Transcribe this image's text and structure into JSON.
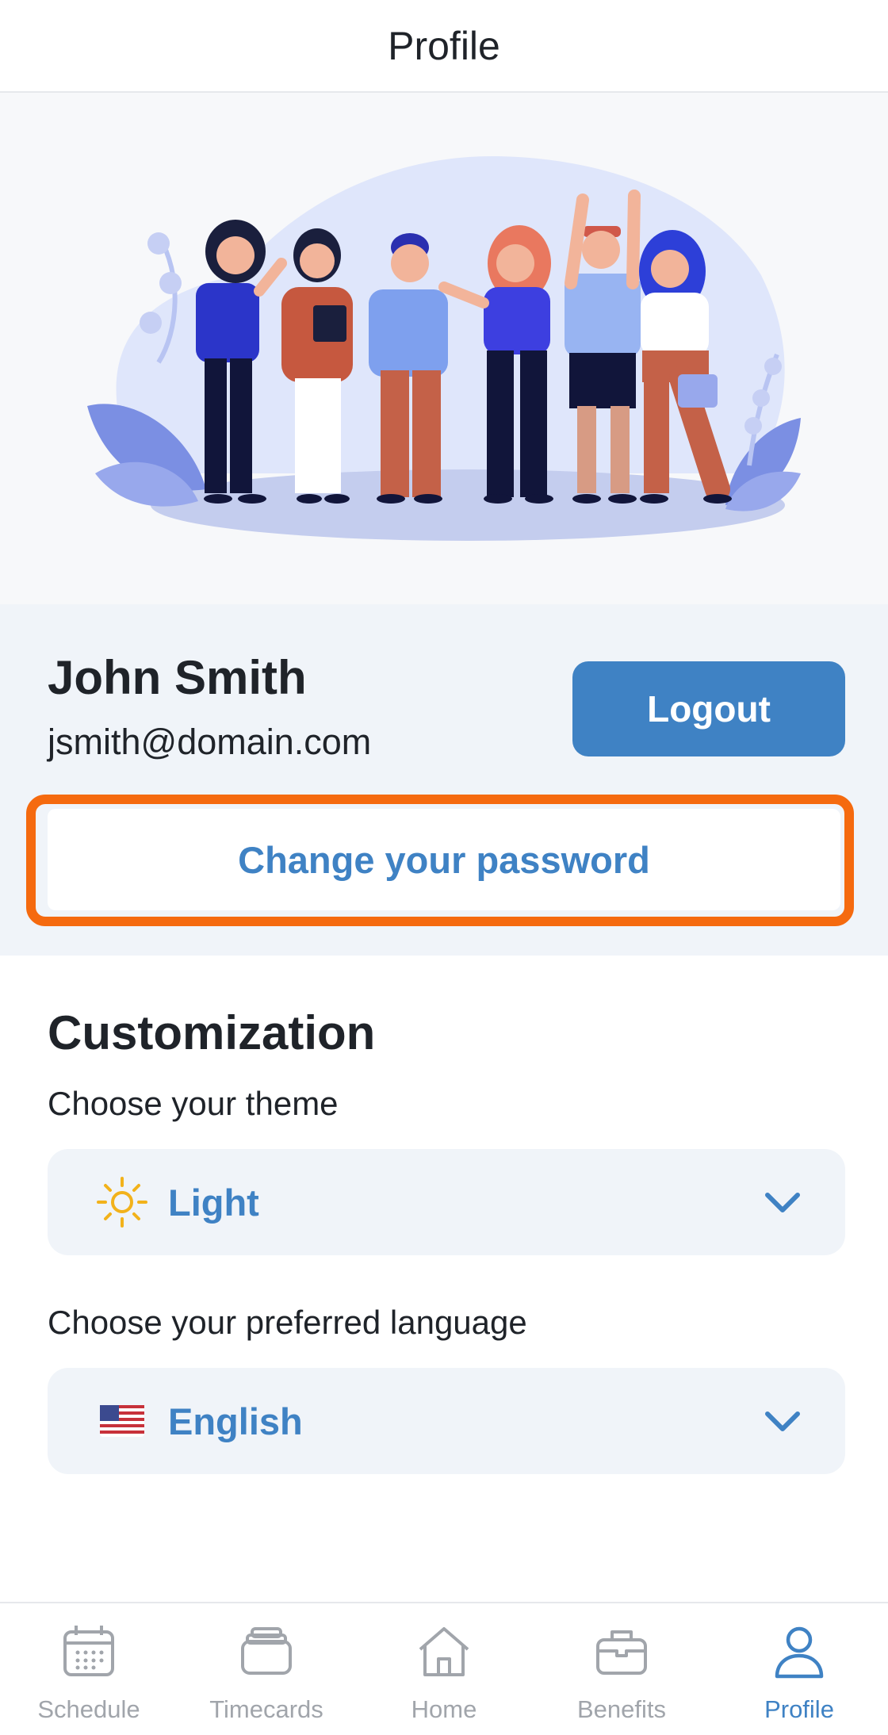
{
  "header": {
    "title": "Profile"
  },
  "user": {
    "name": "John Smith",
    "email": "jsmith@domain.com",
    "logout_label": "Logout",
    "change_password_label": "Change your password"
  },
  "customization": {
    "title": "Customization",
    "theme": {
      "label": "Choose your theme",
      "value": "Light",
      "icon": "sun-icon"
    },
    "language": {
      "label": "Choose your preferred language",
      "value": "English",
      "icon": "us-flag-icon"
    }
  },
  "tabbar": {
    "active": "Profile",
    "tabs": [
      {
        "label": "Schedule",
        "icon": "calendar-icon"
      },
      {
        "label": "Timecards",
        "icon": "timecards-icon"
      },
      {
        "label": "Home",
        "icon": "home-icon"
      },
      {
        "label": "Benefits",
        "icon": "briefcase-icon"
      },
      {
        "label": "Profile",
        "icon": "person-icon"
      }
    ]
  },
  "colors": {
    "accent": "#3f82c4",
    "highlight": "#f56a0f",
    "section_bg": "#f0f4f9",
    "inactive_tab": "#a1a5ab"
  }
}
